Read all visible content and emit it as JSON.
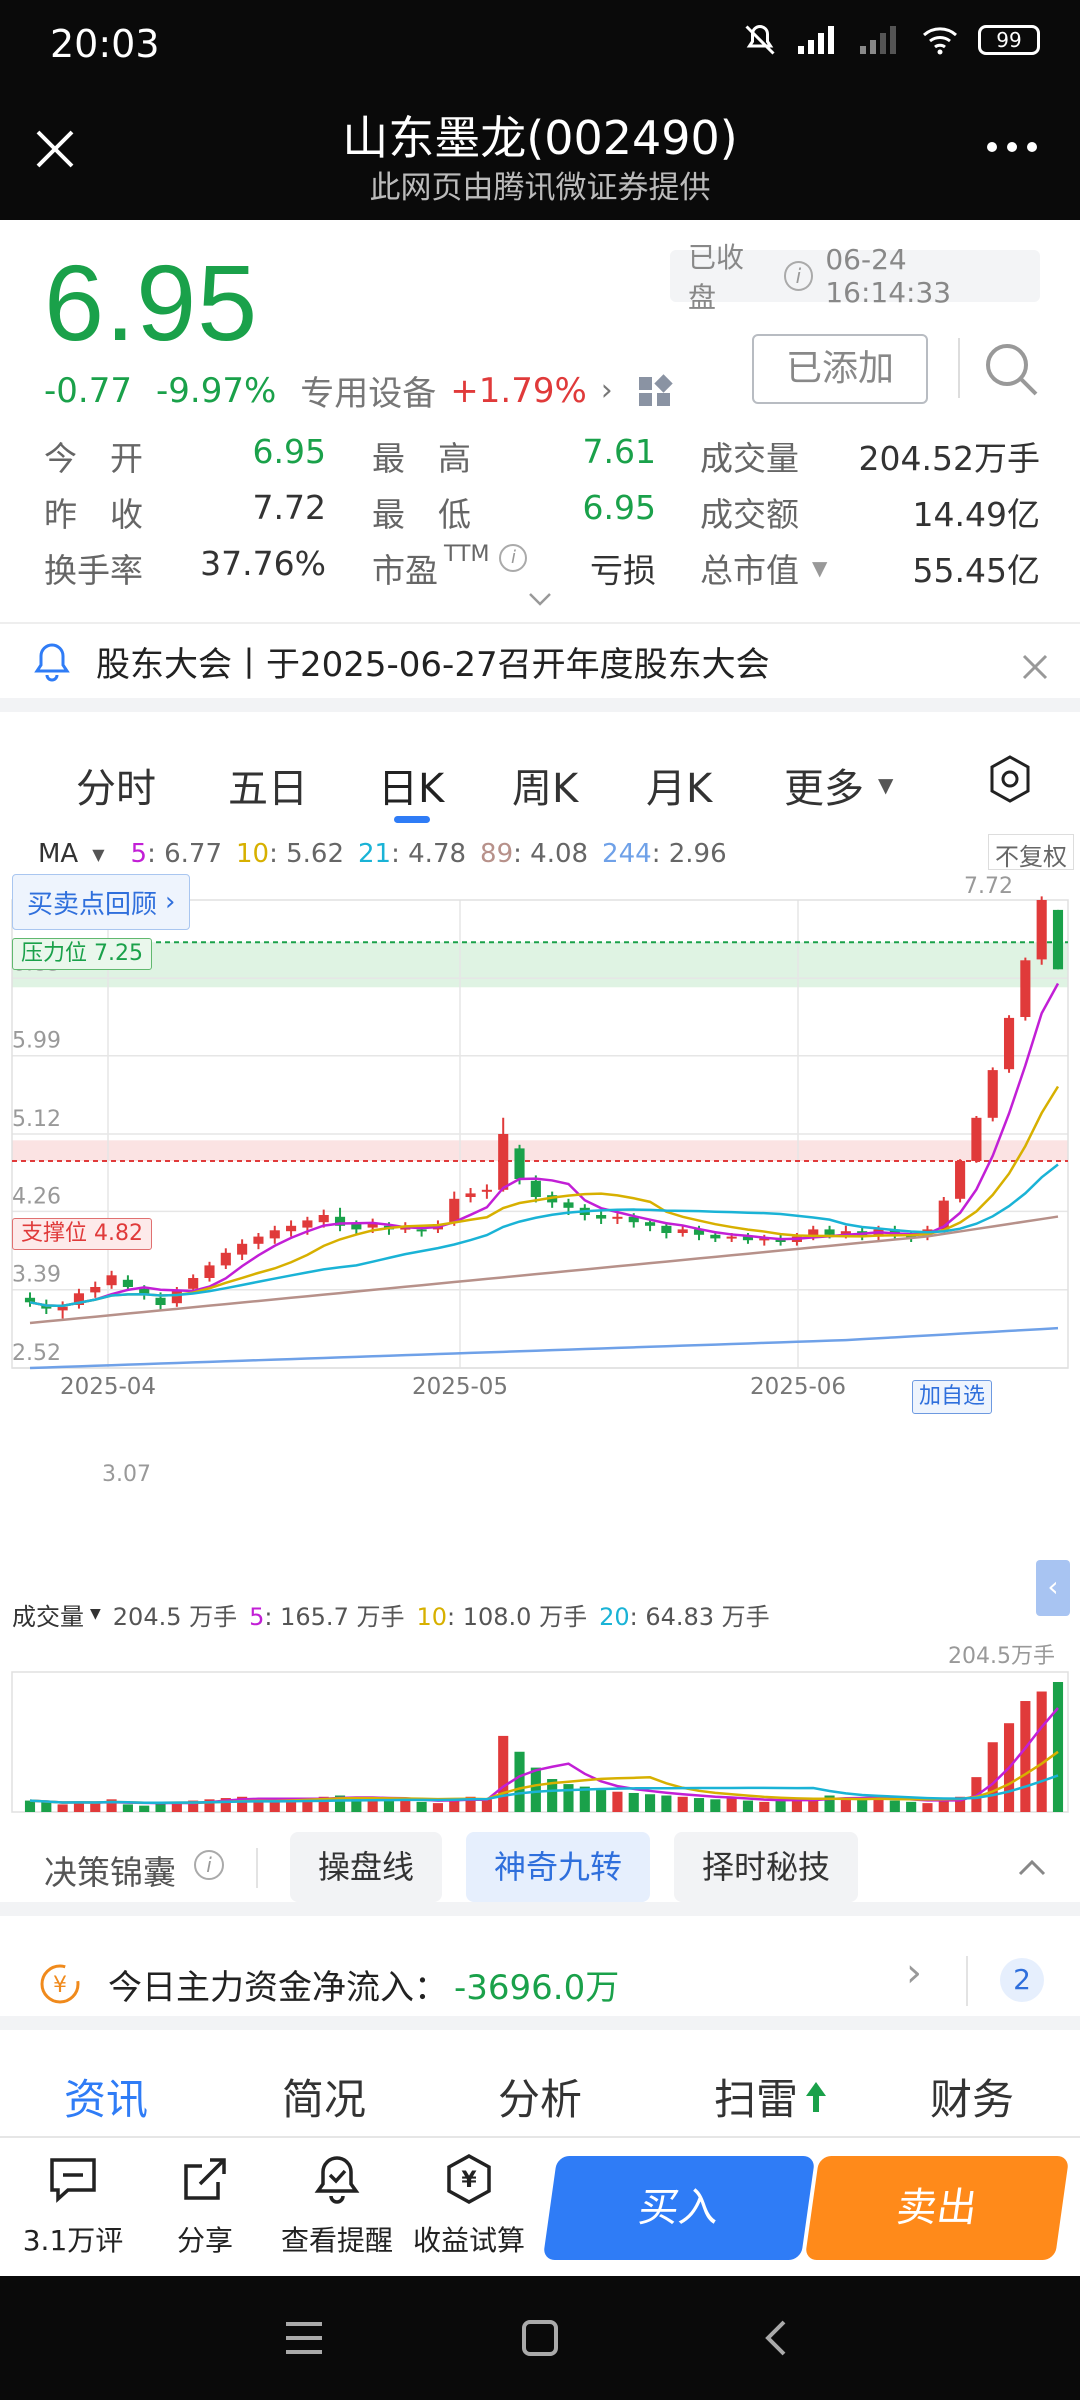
{
  "status": {
    "time": "20:03",
    "battery": "99"
  },
  "title": {
    "main": "山东墨龙(002490)",
    "sub": "此网页由腾讯微证券提供"
  },
  "quote": {
    "price": "6.95",
    "change": "-0.77",
    "change_pct": "-9.97%",
    "sector": "专用设备",
    "sector_pct": "+1.79%",
    "status_label": "已收盘",
    "status_time": "06-24 16:14:33",
    "added_label": "已添加"
  },
  "stats": [
    {
      "label": "今　开",
      "value": "6.95",
      "color": "#1aa14a"
    },
    {
      "label": "最　高",
      "value": "7.61",
      "color": "#1aa14a"
    },
    {
      "label": "成交量",
      "value": "204.52万手",
      "color": "#333333"
    },
    {
      "label": "昨　收",
      "value": "7.72",
      "color": "#333333"
    },
    {
      "label": "最　低",
      "value": "6.95",
      "color": "#1aa14a"
    },
    {
      "label": "成交额",
      "value": "14.49亿",
      "color": "#333333"
    },
    {
      "label": "换手率",
      "value": "37.76%",
      "color": "#333333"
    },
    {
      "label": "市盈TTM",
      "value": "亏损",
      "color": "#333333"
    },
    {
      "label": "总市值",
      "value": "55.45亿",
      "color": "#333333"
    }
  ],
  "notice": "股东大会丨于2025-06-27召开年度股东大会",
  "ktabs": [
    "分时",
    "五日",
    "日K",
    "周K",
    "月K",
    "更多"
  ],
  "ktab_active": 2,
  "ma_legend": {
    "label": "MA",
    "items": [
      {
        "name": "5",
        "value": "6.77",
        "color": "#c21fd6"
      },
      {
        "name": "10",
        "value": "5.62",
        "color": "#d7b000"
      },
      {
        "name": "21",
        "value": "4.78",
        "color": "#1ab3d6"
      },
      {
        "name": "89",
        "value": "4.08",
        "color": "#b7918a"
      },
      {
        "name": "244",
        "value": "2.96",
        "color": "#6fa1e8"
      }
    ],
    "adjust": "不复权"
  },
  "chart_labels": {
    "review": "买卖点回顾",
    "pressure": "压力位 7.25",
    "support": "支撑位 4.82",
    "add_self": "加自选",
    "high_label": "7.72",
    "low_label": "3.07"
  },
  "chart_data": {
    "type": "candlestick",
    "y_ticks": [
      "6.85",
      "5.99",
      "5.12",
      "4.26",
      "3.39",
      "2.52"
    ],
    "y_range": [
      2.52,
      7.72
    ],
    "x_ticks": [
      "2025-04",
      "2025-05",
      "2025-06"
    ],
    "candles": [
      {
        "o": 3.3,
        "c": 3.25,
        "h": 3.36,
        "l": 3.2
      },
      {
        "o": 3.22,
        "c": 3.18,
        "h": 3.28,
        "l": 3.12
      },
      {
        "o": 3.16,
        "c": 3.2,
        "h": 3.26,
        "l": 3.07
      },
      {
        "o": 3.22,
        "c": 3.35,
        "h": 3.4,
        "l": 3.18
      },
      {
        "o": 3.36,
        "c": 3.42,
        "h": 3.48,
        "l": 3.3
      },
      {
        "o": 3.44,
        "c": 3.55,
        "h": 3.6,
        "l": 3.4
      },
      {
        "o": 3.5,
        "c": 3.42,
        "h": 3.55,
        "l": 3.38
      },
      {
        "o": 3.4,
        "c": 3.34,
        "h": 3.44,
        "l": 3.28
      },
      {
        "o": 3.3,
        "c": 3.22,
        "h": 3.36,
        "l": 3.15
      },
      {
        "o": 3.24,
        "c": 3.38,
        "h": 3.42,
        "l": 3.2
      },
      {
        "o": 3.4,
        "c": 3.52,
        "h": 3.56,
        "l": 3.36
      },
      {
        "o": 3.52,
        "c": 3.66,
        "h": 3.7,
        "l": 3.48
      },
      {
        "o": 3.66,
        "c": 3.8,
        "h": 3.85,
        "l": 3.62
      },
      {
        "o": 3.78,
        "c": 3.9,
        "h": 3.95,
        "l": 3.72
      },
      {
        "o": 3.9,
        "c": 3.98,
        "h": 4.02,
        "l": 3.84
      },
      {
        "o": 3.96,
        "c": 4.05,
        "h": 4.1,
        "l": 3.9
      },
      {
        "o": 4.04,
        "c": 4.1,
        "h": 4.16,
        "l": 3.98
      },
      {
        "o": 4.08,
        "c": 4.16,
        "h": 4.2,
        "l": 4.0
      },
      {
        "o": 4.14,
        "c": 4.22,
        "h": 4.28,
        "l": 4.08
      },
      {
        "o": 4.2,
        "c": 4.1,
        "h": 4.3,
        "l": 4.04
      },
      {
        "o": 4.12,
        "c": 4.06,
        "h": 4.16,
        "l": 4.0
      },
      {
        "o": 4.08,
        "c": 4.12,
        "h": 4.18,
        "l": 4.02
      },
      {
        "o": 4.1,
        "c": 4.06,
        "h": 4.14,
        "l": 4.0
      },
      {
        "o": 4.06,
        "c": 4.08,
        "h": 4.14,
        "l": 4.02
      },
      {
        "o": 4.06,
        "c": 4.05,
        "h": 4.1,
        "l": 3.98
      },
      {
        "o": 4.06,
        "c": 4.12,
        "h": 4.16,
        "l": 4.02
      },
      {
        "o": 4.14,
        "c": 4.4,
        "h": 4.48,
        "l": 4.1
      },
      {
        "o": 4.42,
        "c": 4.46,
        "h": 4.52,
        "l": 4.36
      },
      {
        "o": 4.48,
        "c": 4.5,
        "h": 4.56,
        "l": 4.4
      },
      {
        "o": 4.5,
        "c": 5.12,
        "h": 5.3,
        "l": 4.48
      },
      {
        "o": 4.96,
        "c": 4.62,
        "h": 5.0,
        "l": 4.56
      },
      {
        "o": 4.6,
        "c": 4.42,
        "h": 4.66,
        "l": 4.36
      },
      {
        "o": 4.44,
        "c": 4.36,
        "h": 4.48,
        "l": 4.3
      },
      {
        "o": 4.36,
        "c": 4.3,
        "h": 4.4,
        "l": 4.22
      },
      {
        "o": 4.3,
        "c": 4.22,
        "h": 4.34,
        "l": 4.16
      },
      {
        "o": 4.22,
        "c": 4.18,
        "h": 4.28,
        "l": 4.12
      },
      {
        "o": 4.18,
        "c": 4.2,
        "h": 4.24,
        "l": 4.12
      },
      {
        "o": 4.2,
        "c": 4.14,
        "h": 4.24,
        "l": 4.08
      },
      {
        "o": 4.14,
        "c": 4.1,
        "h": 4.18,
        "l": 4.04
      },
      {
        "o": 4.1,
        "c": 4.02,
        "h": 4.14,
        "l": 3.96
      },
      {
        "o": 4.02,
        "c": 4.06,
        "h": 4.1,
        "l": 3.98
      },
      {
        "o": 4.06,
        "c": 4.0,
        "h": 4.1,
        "l": 3.94
      },
      {
        "o": 4.0,
        "c": 3.96,
        "h": 4.04,
        "l": 3.92
      },
      {
        "o": 3.96,
        "c": 3.98,
        "h": 4.02,
        "l": 3.92
      },
      {
        "o": 3.98,
        "c": 3.94,
        "h": 4.02,
        "l": 3.9
      },
      {
        "o": 3.94,
        "c": 3.96,
        "h": 4.0,
        "l": 3.88
      },
      {
        "o": 3.96,
        "c": 3.92,
        "h": 4.0,
        "l": 3.88
      },
      {
        "o": 3.92,
        "c": 3.98,
        "h": 4.02,
        "l": 3.88
      },
      {
        "o": 3.98,
        "c": 4.06,
        "h": 4.1,
        "l": 3.94
      },
      {
        "o": 4.06,
        "c": 4.0,
        "h": 4.1,
        "l": 3.96
      },
      {
        "o": 4.0,
        "c": 4.04,
        "h": 4.1,
        "l": 3.96
      },
      {
        "o": 4.04,
        "c": 3.98,
        "h": 4.08,
        "l": 3.94
      },
      {
        "o": 3.98,
        "c": 4.06,
        "h": 4.1,
        "l": 3.94
      },
      {
        "o": 4.06,
        "c": 4.0,
        "h": 4.1,
        "l": 3.96
      },
      {
        "o": 4.0,
        "c": 3.96,
        "h": 4.04,
        "l": 3.92
      },
      {
        "o": 3.98,
        "c": 4.06,
        "h": 4.1,
        "l": 3.94
      },
      {
        "o": 4.06,
        "c": 4.38,
        "h": 4.42,
        "l": 4.04
      },
      {
        "o": 4.4,
        "c": 4.82,
        "h": 4.84,
        "l": 4.36
      },
      {
        "o": 4.82,
        "c": 5.3,
        "h": 5.32,
        "l": 4.8
      },
      {
        "o": 5.3,
        "c": 5.83,
        "h": 5.86,
        "l": 5.26
      },
      {
        "o": 5.84,
        "c": 6.41,
        "h": 6.44,
        "l": 5.8
      },
      {
        "o": 6.42,
        "c": 7.05,
        "h": 7.08,
        "l": 6.38
      },
      {
        "o": 7.06,
        "c": 7.72,
        "h": 7.76,
        "l": 7.0
      },
      {
        "o": 7.61,
        "c": 6.95,
        "h": 7.61,
        "l": 6.95
      }
    ],
    "volume": {
      "label": "成交量",
      "items": [
        {
          "name": "",
          "value": "204.5 万手",
          "color": "#333333"
        },
        {
          "name": "5",
          "value": "165.7 万手",
          "color": "#c21fd6"
        },
        {
          "name": "10",
          "value": "108.0 万手",
          "color": "#d7b000"
        },
        {
          "name": "20",
          "value": "64.83 万手",
          "color": "#1ab3d6"
        }
      ],
      "max_label": "204.5万手",
      "values": [
        18,
        15,
        12,
        16,
        14,
        20,
        12,
        10,
        14,
        16,
        18,
        20,
        22,
        24,
        20,
        18,
        20,
        22,
        24,
        26,
        22,
        20,
        18,
        22,
        16,
        14,
        22,
        24,
        20,
        120,
        95,
        70,
        52,
        44,
        40,
        36,
        32,
        30,
        28,
        26,
        24,
        22,
        20,
        22,
        18,
        16,
        18,
        20,
        22,
        26,
        22,
        20,
        24,
        18,
        16,
        14,
        20,
        24,
        55,
        110,
        140,
        175,
        190,
        205
      ]
    }
  },
  "tools": {
    "label": "决策锦囊",
    "chips": [
      "操盘线",
      "神奇九转",
      "择时秘技"
    ]
  },
  "fund": {
    "label": "今日主力资金净流入：",
    "value": "-3696.0万",
    "badge": "2"
  },
  "bottom_tabs": [
    "资讯",
    "简况",
    "分析",
    "扫雷",
    "财务"
  ],
  "bottom_bar": {
    "comments": "3.1万评",
    "share": "分享",
    "alert": "查看提醒",
    "calc": "收益试算",
    "buy": "买入",
    "sell": "卖出"
  }
}
